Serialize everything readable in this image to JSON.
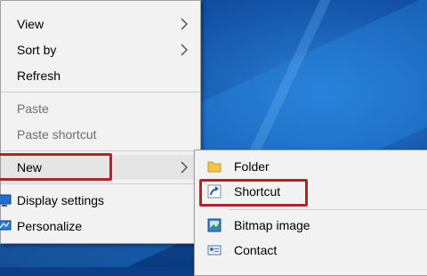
{
  "context_menu": {
    "items": [
      {
        "label": "View",
        "has_submenu": true
      },
      {
        "label": "Sort by",
        "has_submenu": true
      },
      {
        "label": "Refresh"
      },
      {
        "label": "Paste",
        "disabled": true
      },
      {
        "label": "Paste shortcut",
        "disabled": true
      },
      {
        "label": "New",
        "has_submenu": true,
        "highlighted": true
      },
      {
        "label": "Display settings",
        "icon": "display-icon"
      },
      {
        "label": "Personalize",
        "icon": "personalize-icon"
      }
    ]
  },
  "new_submenu": {
    "items": [
      {
        "label": "Folder",
        "icon": "folder-icon"
      },
      {
        "label": "Shortcut",
        "icon": "shortcut-icon",
        "highlighted": true
      },
      {
        "label": "Bitmap image",
        "icon": "bitmap-image-icon"
      },
      {
        "label": "Contact",
        "icon": "contact-icon"
      }
    ]
  },
  "colors": {
    "highlight_box": "#b2222a",
    "menu_background": "#f2f2f2",
    "disabled_text": "#6d6d6d"
  }
}
